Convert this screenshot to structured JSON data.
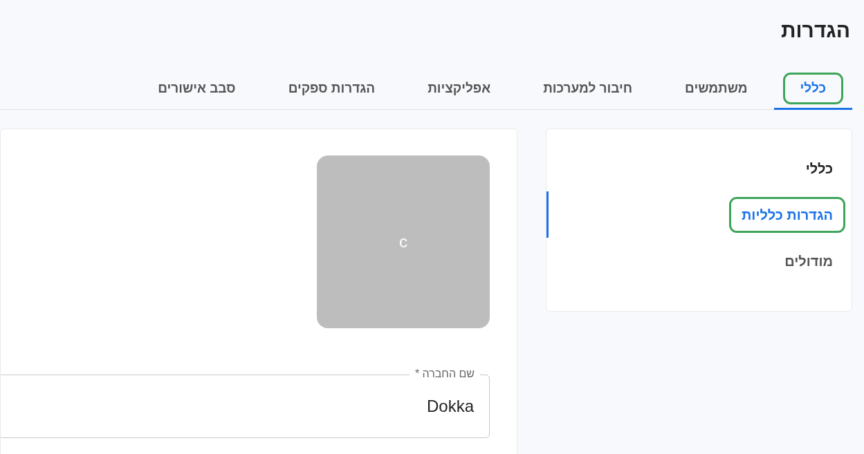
{
  "page_title": "הגדרות",
  "tabs": [
    {
      "label": "כללי",
      "selected": true,
      "highlighted": true
    },
    {
      "label": "משתמשים",
      "selected": false,
      "highlighted": false
    },
    {
      "label": "חיבור למערכות",
      "selected": false,
      "highlighted": false
    },
    {
      "label": "אפליקציות",
      "selected": false,
      "highlighted": false
    },
    {
      "label": "הגדרות ספקים",
      "selected": false,
      "highlighted": false
    },
    {
      "label": "סבב אישורים",
      "selected": false,
      "highlighted": false
    }
  ],
  "sidebar": {
    "heading": "כללי",
    "items": [
      {
        "label": "הגדרות כלליות",
        "selected": true,
        "highlighted": true
      },
      {
        "label": "מודולים",
        "selected": false,
        "highlighted": false
      }
    ]
  },
  "logo": {
    "letter": "c"
  },
  "company_name_field": {
    "label": "שם החברה *",
    "value": "Dokka"
  }
}
